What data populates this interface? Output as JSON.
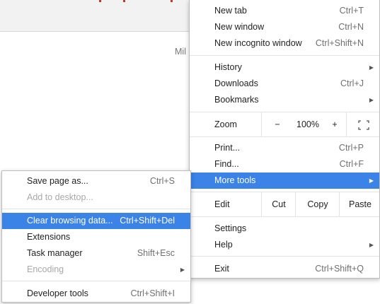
{
  "background": {
    "partial_text": "Mil"
  },
  "main_menu": {
    "new_tab": {
      "label": "New tab",
      "shortcut": "Ctrl+T"
    },
    "new_window": {
      "label": "New window",
      "shortcut": "Ctrl+N"
    },
    "new_incognito": {
      "label": "New incognito window",
      "shortcut": "Ctrl+Shift+N"
    },
    "history": {
      "label": "History"
    },
    "downloads": {
      "label": "Downloads",
      "shortcut": "Ctrl+J"
    },
    "bookmarks": {
      "label": "Bookmarks"
    },
    "zoom": {
      "label": "Zoom",
      "minus": "−",
      "value": "100%",
      "plus": "+",
      "fullscreen": "⛶"
    },
    "print": {
      "label": "Print...",
      "shortcut": "Ctrl+P"
    },
    "find": {
      "label": "Find...",
      "shortcut": "Ctrl+F"
    },
    "more_tools": {
      "label": "More tools"
    },
    "edit": {
      "label": "Edit",
      "cut": "Cut",
      "copy": "Copy",
      "paste": "Paste"
    },
    "settings": {
      "label": "Settings"
    },
    "help": {
      "label": "Help"
    },
    "exit": {
      "label": "Exit",
      "shortcut": "Ctrl+Shift+Q"
    }
  },
  "sub_menu": {
    "save_page": {
      "label": "Save page as...",
      "shortcut": "Ctrl+S"
    },
    "add_to_desktop": {
      "label": "Add to desktop..."
    },
    "clear_browsing": {
      "label": "Clear browsing data...",
      "shortcut": "Ctrl+Shift+Del"
    },
    "extensions": {
      "label": "Extensions"
    },
    "task_manager": {
      "label": "Task manager",
      "shortcut": "Shift+Esc"
    },
    "encoding": {
      "label": "Encoding"
    },
    "developer_tools": {
      "label": "Developer tools",
      "shortcut": "Ctrl+Shift+I"
    }
  },
  "colors": {
    "highlight": "#3b83e6",
    "disabled_text": "#a8a8a8"
  }
}
